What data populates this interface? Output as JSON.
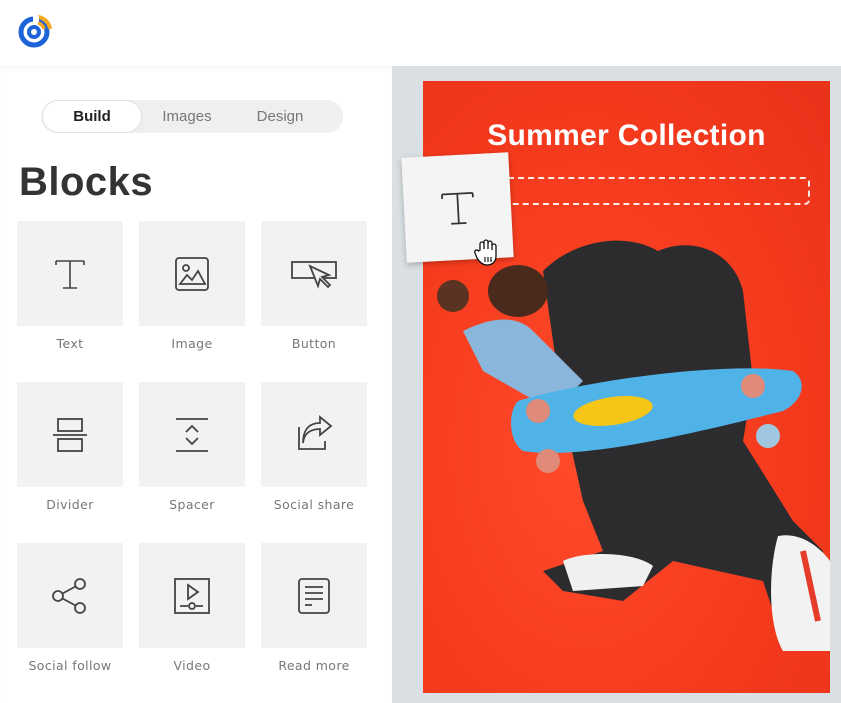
{
  "app": {
    "logo_icon": "constant-contact-logo",
    "brand_colors": {
      "blue": "#1e63d8",
      "orange": "#f5a623"
    }
  },
  "sidebar": {
    "tabs": [
      {
        "label": "Build",
        "active": true
      },
      {
        "label": "Images",
        "active": false
      },
      {
        "label": "Design",
        "active": false
      }
    ],
    "section_title": "Blocks",
    "blocks": [
      {
        "label": "Text",
        "icon": "text-icon"
      },
      {
        "label": "Image",
        "icon": "image-icon"
      },
      {
        "label": "Button",
        "icon": "button-icon"
      },
      {
        "label": "Divider",
        "icon": "divider-icon"
      },
      {
        "label": "Spacer",
        "icon": "spacer-icon"
      },
      {
        "label": "Social share",
        "icon": "social-share-icon"
      },
      {
        "label": "Social follow",
        "icon": "social-follow-icon"
      },
      {
        "label": "Video",
        "icon": "video-icon"
      },
      {
        "label": "Read more",
        "icon": "read-more-icon"
      }
    ]
  },
  "canvas": {
    "headline": "Summer Collection",
    "background_color": "#f53b1d",
    "drop_zone": "text-drop-placeholder",
    "dragging_block": {
      "label": "Text",
      "icon": "text-icon",
      "cursor": "grab-hand-icon"
    }
  }
}
